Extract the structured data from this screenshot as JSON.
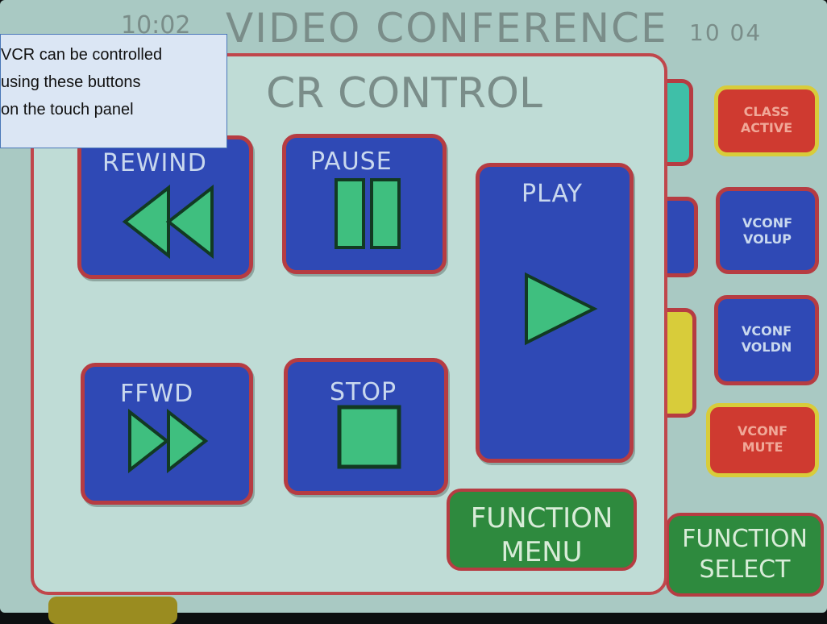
{
  "header": {
    "title": "VIDEO CONFERENCE",
    "time_left": "10:02",
    "time_right": "10 04"
  },
  "popup": {
    "title": "CR CONTROL"
  },
  "buttons": {
    "rewind": "REWIND",
    "pause": "PAUSE",
    "play": "PLAY",
    "ffwd": "FFWD",
    "stop": "STOP",
    "function_menu_1": "FUNCTION",
    "function_menu_2": "MENU"
  },
  "side": {
    "class_active_1": "CLASS",
    "class_active_2": "ACTIVE",
    "vconf_volup_1": "VCONF",
    "vconf_volup_2": "VOLUP",
    "vconf_voldn_1": "VCONF",
    "vconf_voldn_2": "VOLDN",
    "vconf_mute_1": "VCONF",
    "vconf_mute_2": "MUTE",
    "function_select_1": "FUNCTION",
    "function_select_2": "SELECT"
  },
  "tooltip": {
    "line1": "VCR can be controlled",
    "line2": "using these buttons",
    "line3": "on the touch panel"
  },
  "colors": {
    "panel_bg": "#a9c9c3",
    "button_blue": "#2f49b5",
    "button_border": "#b63c42",
    "icon_green": "#3fbf7f",
    "button_green": "#2e8a3e",
    "button_red": "#cf3a30",
    "accent_yellow": "#d8cc3a"
  }
}
